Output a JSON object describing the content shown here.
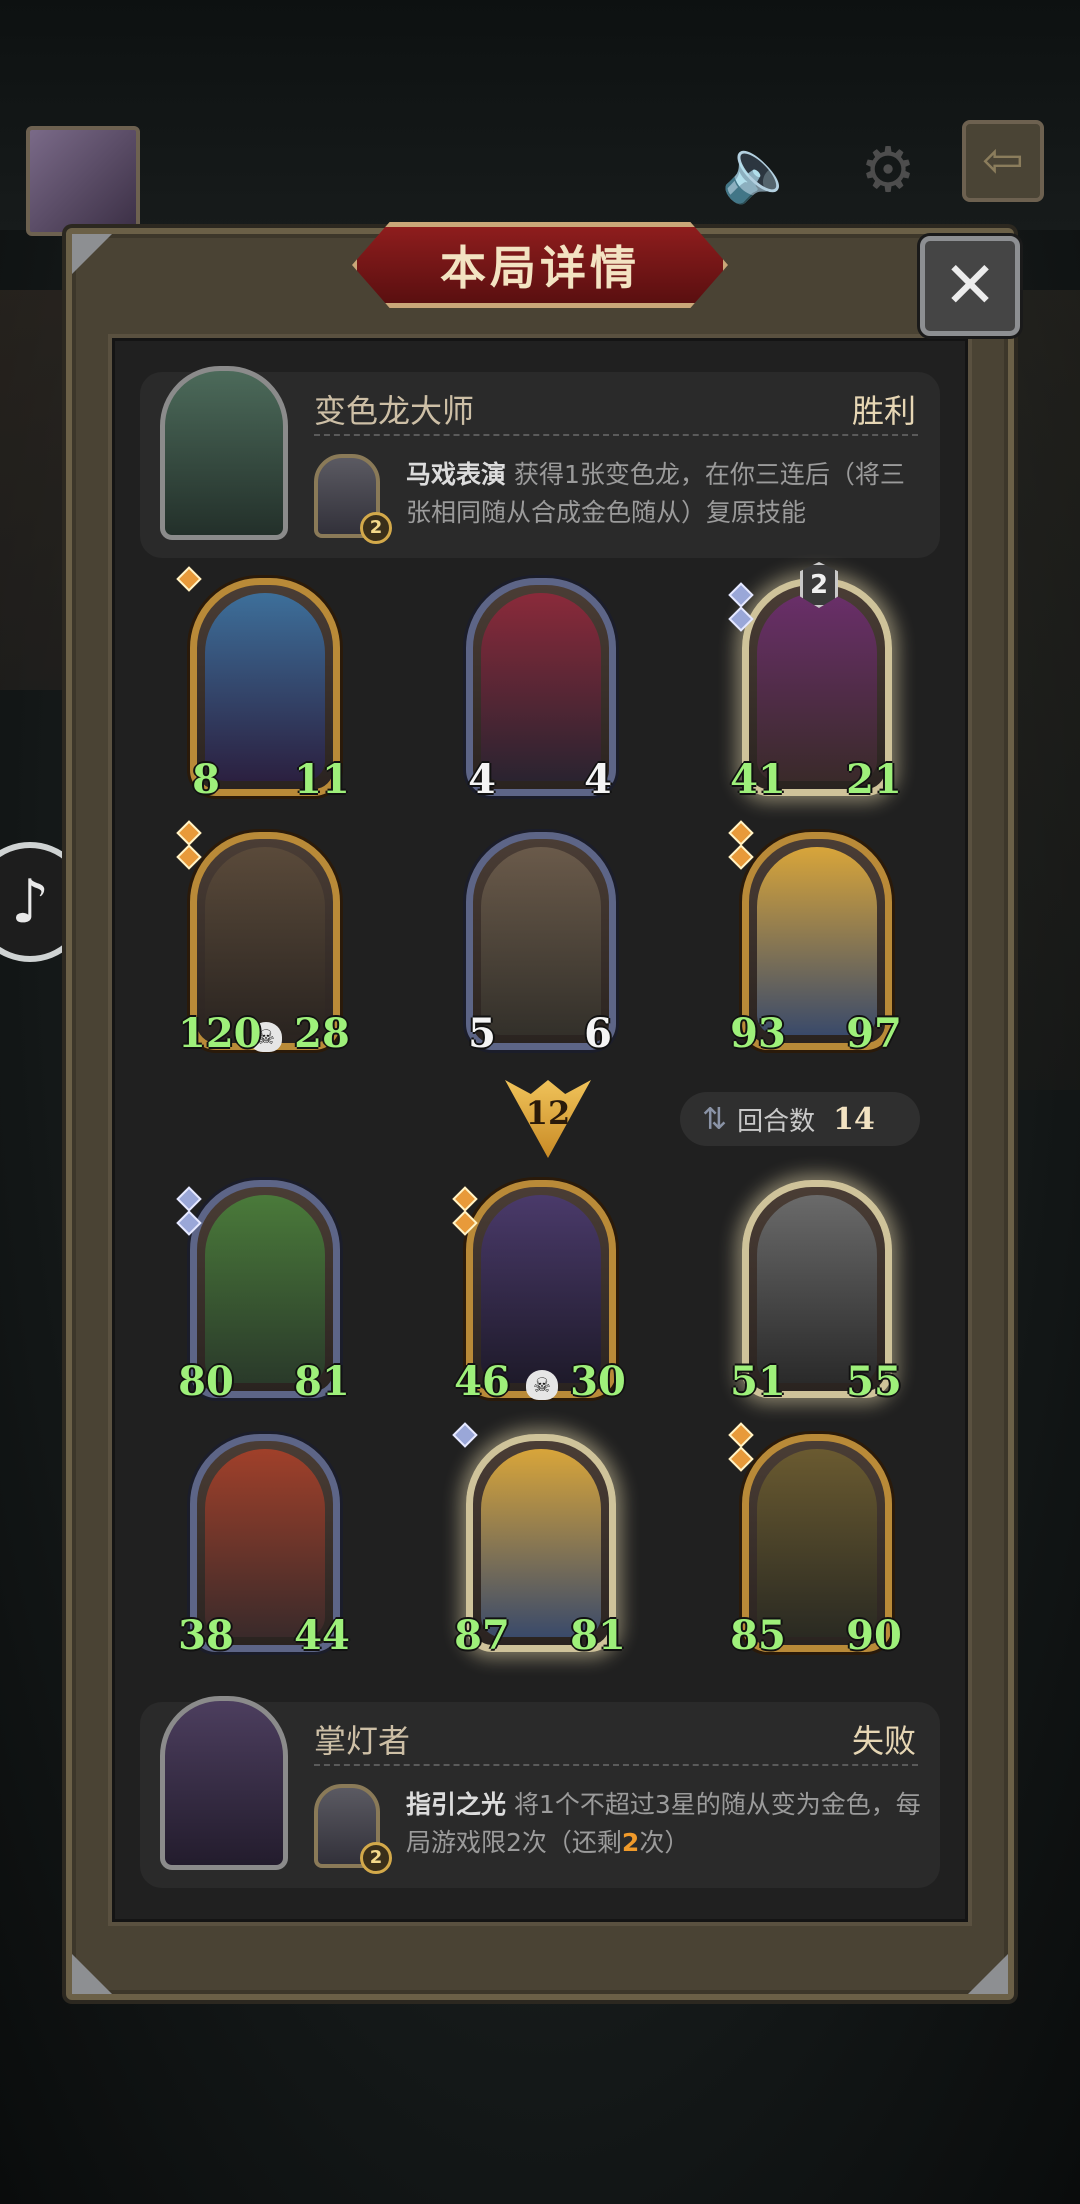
{
  "window": {
    "title": "本局详情"
  },
  "close_label": "✕",
  "top_player": {
    "name": "变色龙大师",
    "result": "胜利",
    "skill_level": "2",
    "skill_name": "马戏表演",
    "skill_desc": " 获得1张变色龙，在你三连后（将三张相同随从合成金色随从）复原技能"
  },
  "top_board": [
    {
      "attack": "8",
      "health": "11"
    },
    {
      "attack": "4",
      "health": "4"
    },
    {
      "attack": "41",
      "health": "21",
      "star": "2"
    },
    {
      "attack": "120",
      "health": "28"
    },
    {
      "attack": "5",
      "health": "6"
    },
    {
      "attack": "93",
      "health": "97"
    }
  ],
  "round": {
    "number": "12",
    "turns_label": "回合数",
    "turns_value": "14"
  },
  "bottom_board": [
    {
      "attack": "80",
      "health": "81"
    },
    {
      "attack": "46",
      "health": "30"
    },
    {
      "attack": "51",
      "health": "55"
    },
    {
      "attack": "38",
      "health": "44"
    },
    {
      "attack": "87",
      "health": "81"
    },
    {
      "attack": "85",
      "health": "90"
    }
  ],
  "bottom_player": {
    "name": "掌灯者",
    "result": "失败",
    "skill_level": "2",
    "skill_name": "指引之光",
    "skill_desc_a": " 将1个不超过3星的随从变为金色，每局游戏限2次（还剩",
    "skill_remaining": "2",
    "skill_desc_b": "次）"
  },
  "colors": {
    "gold_frame": "#b98a38",
    "silver_frame": "#5d6587",
    "hp_green": "#9ef07a",
    "title_red": "#8e1d1d"
  },
  "icons": [
    "speaker-icon",
    "gear-icon",
    "exit-icon",
    "close-icon",
    "skull-icon",
    "swap-icon",
    "tiktok-icon"
  ]
}
